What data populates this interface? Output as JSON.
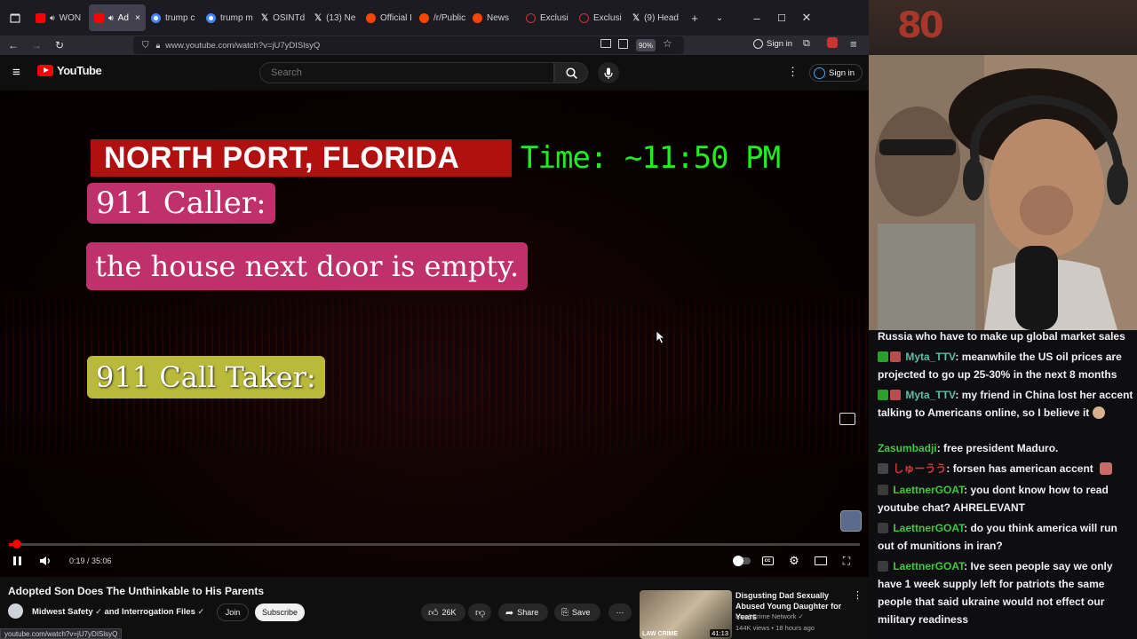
{
  "browser": {
    "tabs": [
      {
        "label": "WON"
      },
      {
        "label": "Ad"
      },
      {
        "label": "trump c"
      },
      {
        "label": "trump m"
      },
      {
        "label": "OSINTd"
      },
      {
        "label": "(13) Ne"
      },
      {
        "label": "Official I"
      },
      {
        "label": "/r/Public"
      },
      {
        "label": "News"
      },
      {
        "label": "Exclusi"
      },
      {
        "label": "Exclusi"
      },
      {
        "label": "(9) Head"
      }
    ],
    "url": "www.youtube.com/watch?v=jU7yDISlsyQ",
    "zoom": "90%",
    "sign_in": "Sign in",
    "status_url": "youtube.com/watch?v=jU7yDISlsyQ"
  },
  "youtube": {
    "logo_text": "YouTube",
    "search_placeholder": "Search",
    "sign_in": "Sign in"
  },
  "player": {
    "captions": {
      "location": "NORTH PORT, FLORIDA",
      "time": "Time: ~11:50 PM",
      "caller_label": "911 Caller:",
      "caller_quote": "the house next door is empty.",
      "taker_label": "911 Call Taker:"
    },
    "current_time": "0:19",
    "duration": "35:06",
    "time_display": "0:19 / 35:06",
    "progress_fraction": 0.009
  },
  "video": {
    "title": "Adopted Son Does The Unthinkable to His Parents",
    "channel": "Midwest Safety",
    "channel_collab": "and Interrogation Files",
    "join": "Join",
    "subscribe": "Subscribe",
    "likes": "26K",
    "share": "Share",
    "save": "Save"
  },
  "recommended": {
    "title": "Disgusting Dad Sexually Abused Young Daughter for Years",
    "channel": "Law&Crime Network",
    "meta": "144K views • 18 hours ago",
    "duration": "41:13",
    "thumb_brand": "LAW CRIME"
  },
  "chat": {
    "messages": [
      {
        "user": "",
        "text": "Russia who have to make up global market sales"
      },
      {
        "user": "Myta_TTV",
        "text": ": meanwhile the US oil prices are projected to go up 25-30% in the next 8 months"
      },
      {
        "user": "Myta_TTV",
        "text": ": my friend in China lost her accent talking to Americans online, so I believe it"
      },
      {
        "user": "Zasumbadji",
        "text": ": free president Maduro."
      },
      {
        "user": "しゅーうう",
        "text": ": forsen has american accent"
      },
      {
        "user": "LaettnerGOAT",
        "text": ": you dont know how to read youtube chat? AHRELEVANT"
      },
      {
        "user": "LaettnerGOAT",
        "text": ": do you think america will run out of munitions in iran?"
      },
      {
        "user": "LaettnerGOAT",
        "text": ": Ive seen people say we only have 1 week supply left for patriots the same people that said ukraine would not effect our military readiness"
      }
    ]
  },
  "colors": {
    "yt_red": "#ff0000",
    "caption_red": "#b01010",
    "caption_pink": "#c0306a",
    "caption_yellow": "#b9b93a",
    "time_green": "#1ef01e",
    "chat_green": "#3ec93e"
  }
}
